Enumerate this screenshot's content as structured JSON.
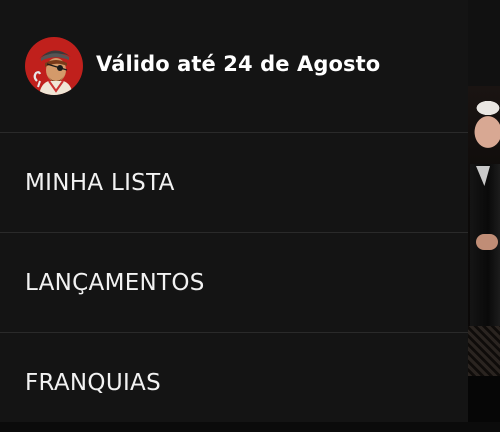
{
  "header": {
    "validity_text": "Válido até 24 de Agosto",
    "avatar_icon": "pirate-mascot-icon",
    "avatar_bg": "#c0201c"
  },
  "menu": {
    "items": [
      {
        "label": "MINHA LISTA"
      },
      {
        "label": "LANÇAMENTOS"
      },
      {
        "label": "FRANQUIAS"
      }
    ]
  },
  "colors": {
    "drawer_bg": "#141414",
    "divider": "#2a2a2a",
    "text": "#ffffff"
  }
}
